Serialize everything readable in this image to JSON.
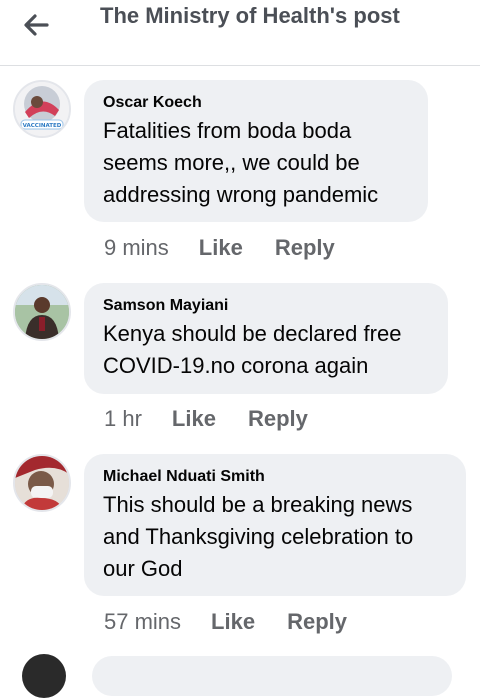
{
  "header": {
    "title": "The Ministry of Health's post"
  },
  "comments": [
    {
      "author": "Oscar Koech",
      "text": "Fatalities from boda boda seems more,, we could be addressing wrong pandemic",
      "time": "9 mins",
      "like_label": "Like",
      "reply_label": "Reply",
      "avatar_badge": "VACCINATED"
    },
    {
      "author": "Samson Mayiani",
      "text": "Kenya should be declared free COVID-19.no corona again",
      "time": "1 hr",
      "like_label": "Like",
      "reply_label": "Reply"
    },
    {
      "author": "Michael Nduati Smith",
      "text": "This should be a breaking news and Thanksgiving celebration to our God",
      "time": "57 mins",
      "like_label": "Like",
      "reply_label": "Reply"
    }
  ]
}
